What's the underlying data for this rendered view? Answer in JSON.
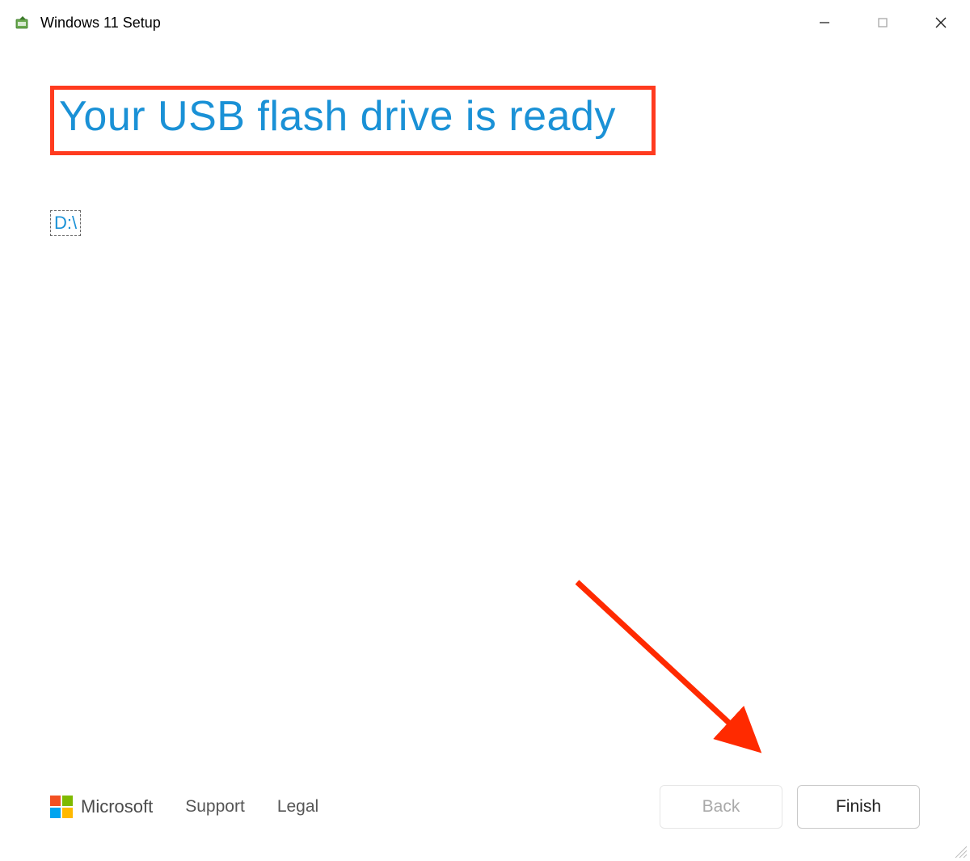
{
  "titlebar": {
    "title": "Windows 11 Setup"
  },
  "main": {
    "heading": "Your USB flash drive is ready",
    "drive_letter": "D:\\"
  },
  "footer": {
    "brand": "Microsoft",
    "support_label": "Support",
    "legal_label": "Legal",
    "back_label": "Back",
    "finish_label": "Finish"
  },
  "colors": {
    "accent": "#1a91d6",
    "highlight_box": "#ff3b1f",
    "annotation_arrow": "#ff2a00"
  }
}
